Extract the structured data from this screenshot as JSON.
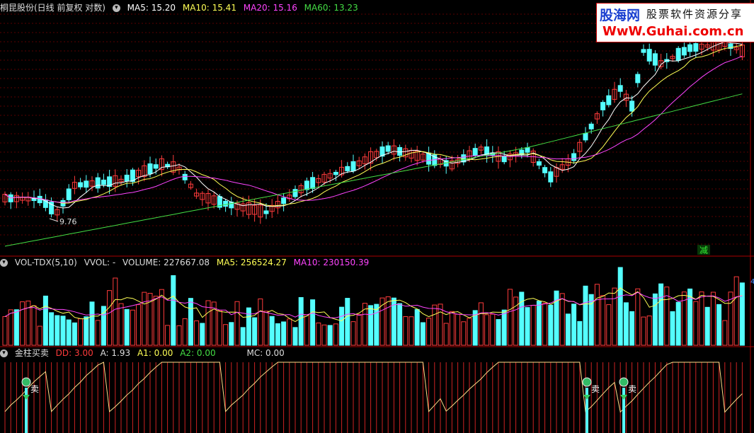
{
  "price_panel": {
    "stock_title": "桐昆股份(日线 前复权 对数)",
    "ma5": "MA5: 15.20",
    "ma10": "MA10: 15.41",
    "ma20": "MA20: 15.16",
    "ma60": "MA60: 13.23",
    "low_marker": "9.76",
    "reduce_flag": "减",
    "colors": {
      "ma5": "#ffffff",
      "ma10": "#ffff55",
      "ma20": "#ff44ff",
      "ma60": "#44dd44",
      "up": "#ff3b3b",
      "down": "#54ffff"
    }
  },
  "volume_panel": {
    "indicator": "VOL-TDX(5,10)",
    "vvol": "VVOL: -",
    "volume": "VOLUME: 227667.08",
    "ma5": "MA5: 256524.27",
    "ma10": "MA10: 230150.39",
    "axis_mark": "4"
  },
  "signal_panel": {
    "indicator": "金柱买卖",
    "dd": "DD: 3.00",
    "a": "A: 1.93",
    "a1": "A1: 0.00",
    "a2": "A2: 0.00",
    "mc": "MC: 0.00",
    "sell_label": "卖"
  },
  "watermark": {
    "brand": "股海网",
    "slogan": "股票软件资源分享",
    "url": "WwW.Guhai.com.cn"
  }
}
